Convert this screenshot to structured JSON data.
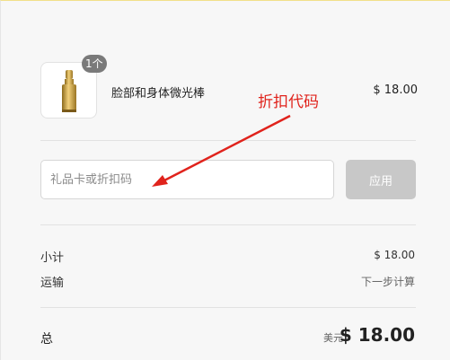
{
  "product": {
    "quantity_badge": "1个",
    "name": "脸部和身体微光棒",
    "price": "$ 18.00",
    "image_icon": "lipstick-product-image"
  },
  "annotation": {
    "text": "折扣代码",
    "color": "#e0231c"
  },
  "discount": {
    "placeholder": "礼品卡或折扣码",
    "value": "",
    "apply_label": "应用"
  },
  "summary": {
    "subtotal_label": "小计",
    "subtotal_value": "$ 18.00",
    "shipping_label": "运输",
    "shipping_value": "下一步计算"
  },
  "total": {
    "label": "总",
    "currency": "美元",
    "amount": "$ 18.00"
  },
  "colors": {
    "apply_button_disabled": "#c8c8c8",
    "badge": "#7a7a7a",
    "product_gold": "#c9a23a"
  }
}
